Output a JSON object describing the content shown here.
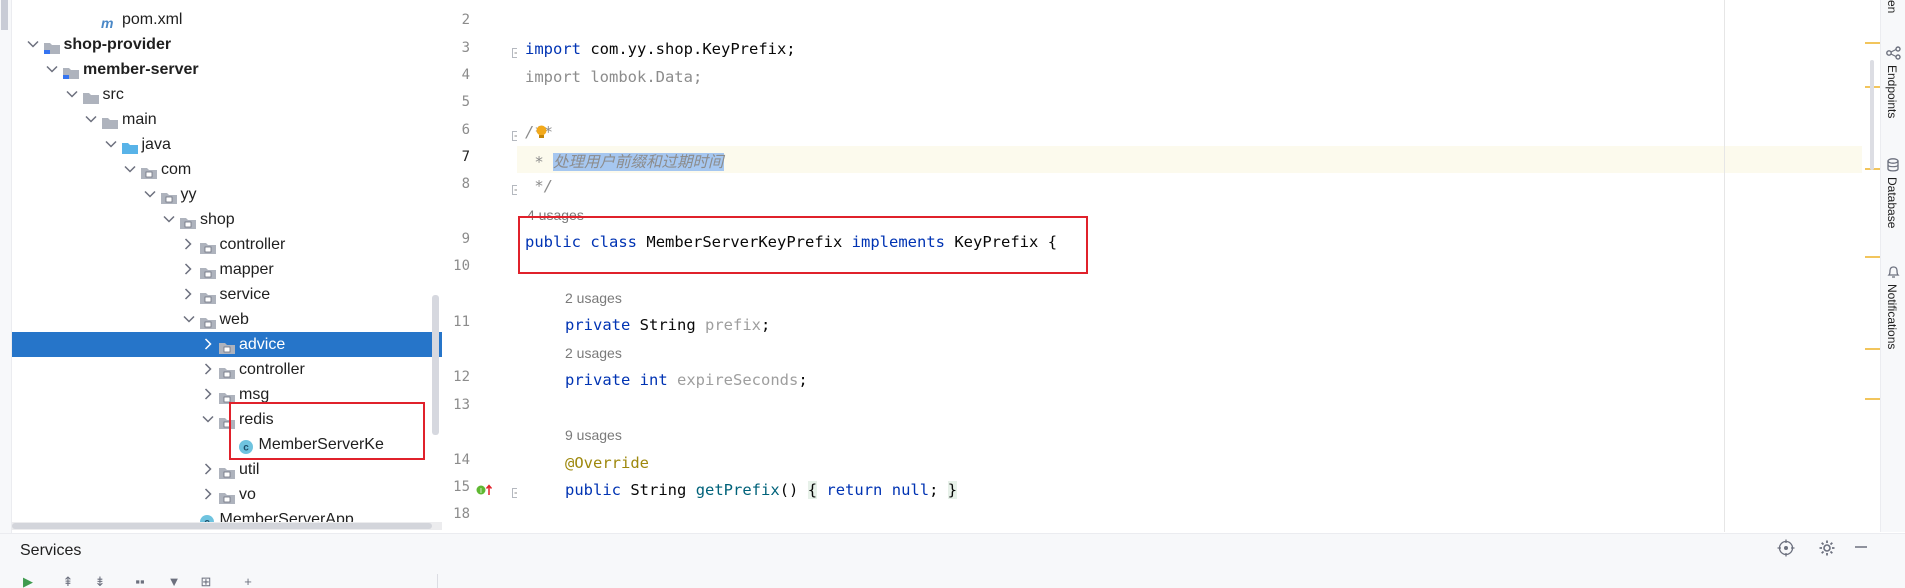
{
  "project_tree": {
    "items": [
      {
        "label": "pom.xml",
        "type": "maven-file",
        "depth": 4,
        "expanded": null,
        "bold": false,
        "selected": false
      },
      {
        "label": "shop-provider",
        "type": "module",
        "depth": 1,
        "expanded": true,
        "bold": true,
        "selected": false
      },
      {
        "label": "member-server",
        "type": "module",
        "depth": 2,
        "expanded": true,
        "bold": true,
        "selected": false
      },
      {
        "label": "src",
        "type": "folder",
        "depth": 3,
        "expanded": true,
        "bold": false,
        "selected": false
      },
      {
        "label": "main",
        "type": "folder",
        "depth": 4,
        "expanded": true,
        "bold": false,
        "selected": false
      },
      {
        "label": "java",
        "type": "source-folder",
        "depth": 5,
        "expanded": true,
        "bold": false,
        "selected": false
      },
      {
        "label": "com",
        "type": "package",
        "depth": 6,
        "expanded": true,
        "bold": false,
        "selected": false
      },
      {
        "label": "yy",
        "type": "package",
        "depth": 7,
        "expanded": true,
        "bold": false,
        "selected": false
      },
      {
        "label": "shop",
        "type": "package",
        "depth": 8,
        "expanded": true,
        "bold": false,
        "selected": false
      },
      {
        "label": "controller",
        "type": "package",
        "depth": 9,
        "expanded": false,
        "bold": false,
        "selected": false
      },
      {
        "label": "mapper",
        "type": "package",
        "depth": 9,
        "expanded": false,
        "bold": false,
        "selected": false
      },
      {
        "label": "service",
        "type": "package",
        "depth": 9,
        "expanded": false,
        "bold": false,
        "selected": false
      },
      {
        "label": "web",
        "type": "package",
        "depth": 9,
        "expanded": true,
        "bold": false,
        "selected": false
      },
      {
        "label": "advice",
        "type": "package",
        "depth": 10,
        "expanded": false,
        "bold": false,
        "selected": true
      },
      {
        "label": "controller",
        "type": "package",
        "depth": 10,
        "expanded": false,
        "bold": false,
        "selected": false
      },
      {
        "label": "msg",
        "type": "package",
        "depth": 10,
        "expanded": false,
        "bold": false,
        "selected": false
      },
      {
        "label": "redis",
        "type": "package",
        "depth": 10,
        "expanded": true,
        "bold": false,
        "selected": false
      },
      {
        "label": "MemberServerKe",
        "type": "class",
        "depth": 11,
        "expanded": null,
        "bold": false,
        "selected": false
      },
      {
        "label": "util",
        "type": "package",
        "depth": 10,
        "expanded": false,
        "bold": false,
        "selected": false
      },
      {
        "label": "vo",
        "type": "package",
        "depth": 10,
        "expanded": false,
        "bold": false,
        "selected": false
      },
      {
        "label": "MemberServerApp",
        "type": "spring-class",
        "depth": 9,
        "expanded": null,
        "bold": false,
        "selected": false
      }
    ]
  },
  "editor": {
    "line_numbers": [
      "2",
      "3",
      "4",
      "5",
      "6",
      "7",
      "8",
      "9",
      "10",
      "11",
      "12",
      "13",
      "14",
      "15",
      "18"
    ],
    "import_1": {
      "kw": "import",
      "rest": "com.yy.shop.KeyPrefix;"
    },
    "import_2": "import lombok.Data;",
    "javadoc_open": "/**",
    "javadoc_star": " * ",
    "javadoc_text": "处理用户前缀和过期时间",
    "javadoc_close": " */",
    "usages_class": "4 usages",
    "class_decl": {
      "kw1": "public",
      "kw2": "class",
      "name": "MemberServerKeyPrefix",
      "kw3": "implements",
      "iface": "KeyPrefix",
      "brace": "{"
    },
    "usages_prefix": "2 usages",
    "field_prefix": {
      "kw": "private",
      "type": "String",
      "name": "prefix",
      "semi": ";"
    },
    "usages_expire": "2 usages",
    "field_expire": {
      "kw": "private",
      "type": "int",
      "name": "expireSeconds",
      "semi": ";"
    },
    "usages_method": "9 usages",
    "annotation": "@Override",
    "method": {
      "kw": "public",
      "type": "String",
      "name": "getPrefix",
      "parens": "()",
      "body_open": "{",
      "ret": "return",
      "nul": "null",
      "semi": ";",
      "body_close": "}"
    }
  },
  "right_sidebar": {
    "tabs": [
      "Endpoints",
      "Database",
      "Notifications"
    ],
    "top_fragment": "ven"
  },
  "services": {
    "title": "Services"
  },
  "colors": {
    "selection_blue": "#2675c9",
    "highlight_red": "#e0212b",
    "keyword": "#0033b3",
    "current_line": "#fcfaed"
  }
}
